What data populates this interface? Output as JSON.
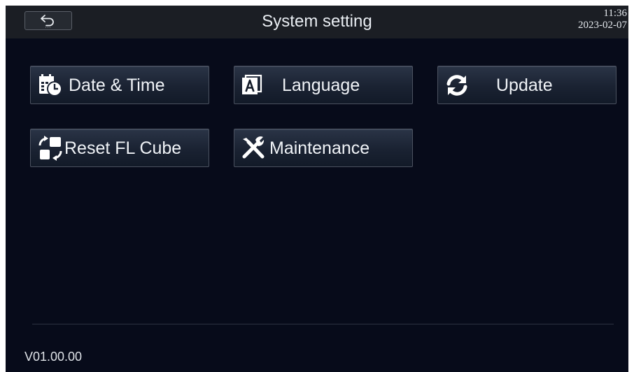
{
  "header": {
    "title": "System setting",
    "time": "11:36",
    "date": "2023-02-07",
    "back_icon": "back-arrow-icon"
  },
  "menu": [
    {
      "id": "date-time",
      "label": "Date & Time",
      "icon": "calendar-clock-icon"
    },
    {
      "id": "language",
      "label": "Language",
      "icon": "language-a-icon"
    },
    {
      "id": "update",
      "label": "Update",
      "icon": "refresh-icon"
    },
    {
      "id": "reset-fl-cube",
      "label": "Reset FL Cube",
      "icon": "reset-cube-icon"
    },
    {
      "id": "maintenance",
      "label": "Maintenance",
      "icon": "wrench-screwdriver-icon"
    }
  ],
  "footer": {
    "version": "V01.00.00"
  },
  "colors": {
    "background": "#070b1a",
    "header": "#1b1e24",
    "text": "#f0f3f7"
  }
}
